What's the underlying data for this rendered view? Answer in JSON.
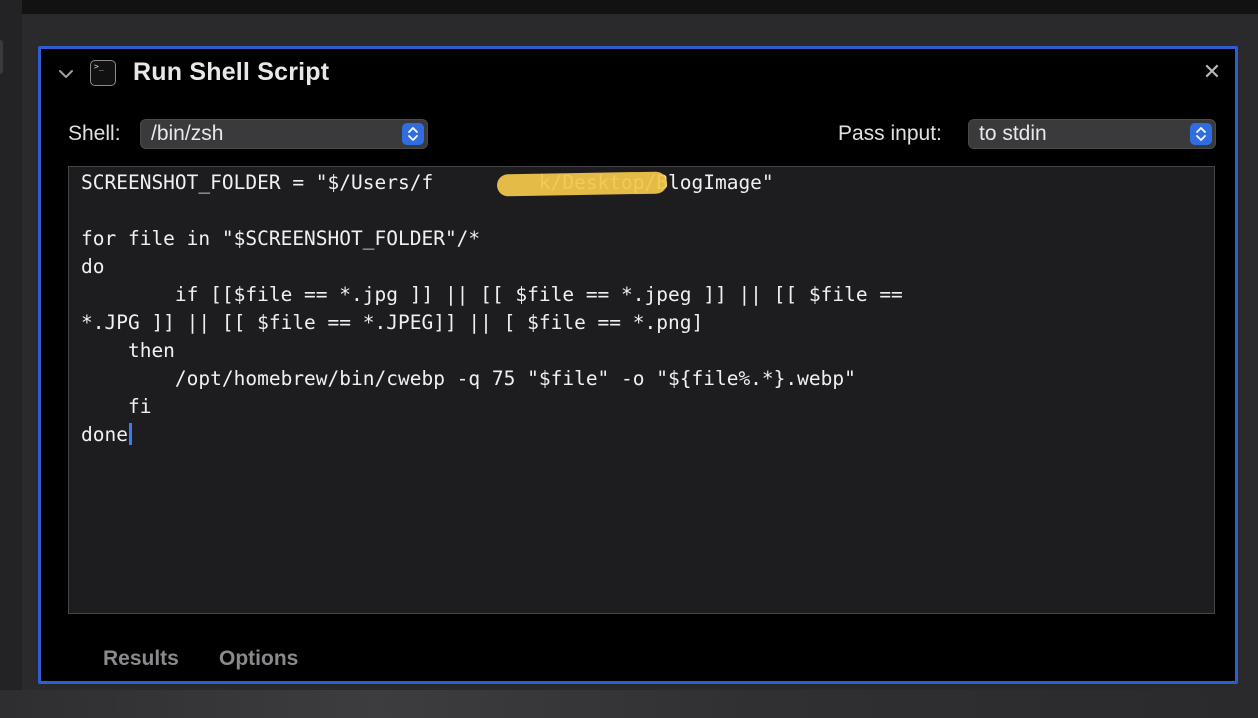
{
  "action": {
    "title": "Run Shell Script",
    "icon": "terminal-icon",
    "accent_color": "#2f5bd3"
  },
  "shell": {
    "label": "Shell:",
    "value": "/bin/zsh"
  },
  "pass_input": {
    "label": "Pass input:",
    "value": "to stdin"
  },
  "script": {
    "lines": [
      "SCREENSHOT_FOLDER = \"$/Users/f         k/Desktop/BlogImage\"",
      "",
      "for file in \"$SCREENSHOT_FOLDER\"/*",
      "do",
      "        if [[$file == *.jpg ]] || [[ $file == *.jpeg ]] || [[ $file ==",
      "*.JPG ]] || [[ $file == *.JPEG]] || [ $file == *.png]",
      "    then",
      "        /opt/homebrew/bin/cwebp -q 75 \"$file\" -o \"${file%.*}.webp\"",
      "    fi",
      "done"
    ]
  },
  "tabs": {
    "results": "Results",
    "options": "Options"
  }
}
